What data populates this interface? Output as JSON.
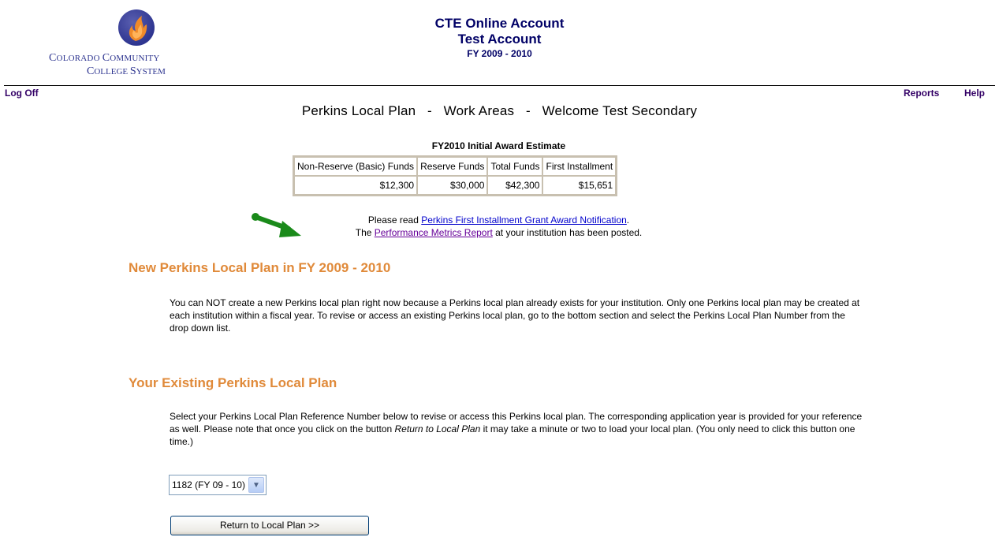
{
  "logo": {
    "line1_big": "C",
    "line1_small": "OLORADO ",
    "line1b_big": "C",
    "line1b_small": "OMMUNITY",
    "line2_big": "C",
    "line2_small": "OLLEGE ",
    "line2b_big": "S",
    "line2b_small": "YSTEM"
  },
  "header": {
    "title1": "CTE Online Account",
    "title2": "Test Account",
    "fiscal_year": "FY 2009 - 2010"
  },
  "nav": {
    "log_off": "Log Off",
    "reports": "Reports",
    "help": "Help"
  },
  "page_heading": "Perkins Local Plan   -   Work Areas   -   Welcome Test Secondary",
  "award": {
    "caption": "FY2010 Initial Award Estimate",
    "columns": [
      "Non-Reserve (Basic) Funds",
      "Reserve Funds",
      "Total Funds",
      "First Installment"
    ],
    "values": [
      "$12,300",
      "$30,000",
      "$42,300",
      "$15,651"
    ]
  },
  "notice": {
    "line1_prefix": "Please read ",
    "line1_link": "Perkins First Installment Grant Award Notification",
    "line1_suffix": ".",
    "line2_prefix": "The ",
    "line2_link": "Performance Metrics Report",
    "line2_suffix": " at your institution has been posted."
  },
  "new_plan": {
    "title": "New Perkins Local Plan in FY 2009 - 2010",
    "text": "You can NOT create a new Perkins local plan right now because a Perkins local plan already exists for your institution. Only one Perkins local plan may be created at each institution within a fiscal year. To revise or access an existing Perkins local plan, go to the bottom section and select the Perkins Local Plan Number from the drop down list."
  },
  "existing_plan": {
    "title": "Your Existing Perkins Local Plan",
    "text_before": "Select your Perkins Local Plan Reference Number below to revise or access this Perkins local plan. The corresponding application year is provided for your reference as well. Please note that once you click on the button ",
    "text_italic": "Return to Local Plan",
    "text_after": " it may take a minute or two to load your local plan. (You only need to click this button one time.)",
    "select_value": "1182 (FY 09 - 10)",
    "button_label": "Return to Local Plan >>"
  },
  "colors": {
    "section_title": "#e08a3a",
    "header_text": "#000066",
    "nav_link": "#330066",
    "link": "#0000cc",
    "visited_link": "#660099",
    "arrow": "#1a8a1a"
  },
  "icons": {
    "logo": "flame-circle-icon",
    "arrow": "green-arrow-icon",
    "dropdown": "chevron-down-icon"
  }
}
